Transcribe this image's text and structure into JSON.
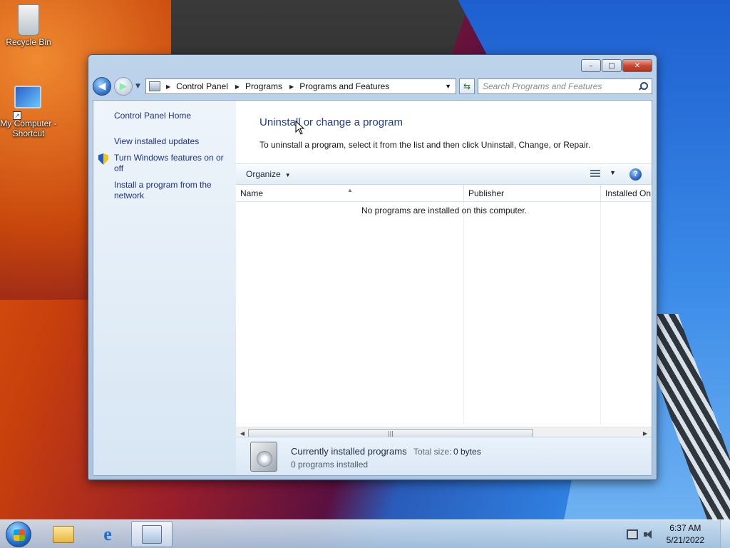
{
  "desktop": {
    "icons": [
      {
        "label": "Recycle Bin"
      },
      {
        "label": "My Computer - Shortcut"
      }
    ]
  },
  "window": {
    "caption_buttons": {
      "minimize": "–",
      "maximize": "□",
      "close": "✕"
    },
    "address": {
      "breadcrumbs": [
        "Control Panel",
        "Programs",
        "Programs and Features"
      ],
      "search_placeholder": "Search Programs and Features"
    },
    "left_pane": {
      "links": [
        "Control Panel Home",
        "View installed updates",
        "Turn Windows features on or off",
        "Install a program from the network"
      ]
    },
    "header": {
      "title": "Uninstall or change a program",
      "subtitle": "To uninstall a program, select it from the list and then click Uninstall, Change, or Repair."
    },
    "commandbar": {
      "organize": "Organize"
    },
    "columns": [
      "Name",
      "Publisher",
      "Installed On"
    ],
    "empty_message": "No programs are installed on this computer.",
    "details": {
      "title": "Currently installed programs",
      "total_size_label": "Total size:",
      "total_size_value": "0 bytes",
      "count": "0 programs installed"
    }
  },
  "taskbar": {
    "clock_time": "6:37 AM",
    "clock_date": "5/21/2022"
  },
  "icons": {
    "start": "windows-start-orb",
    "explorer": "folder-explorer-icon",
    "ie": "internet-explorer-icon",
    "control_panel": "control-panel-icon"
  }
}
